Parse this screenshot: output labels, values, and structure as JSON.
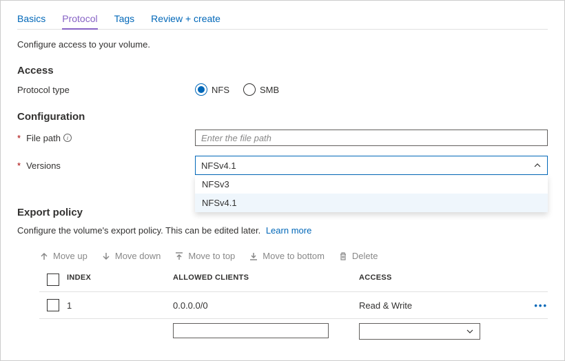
{
  "tabs": {
    "basics": "Basics",
    "protocol": "Protocol",
    "tags": "Tags",
    "review": "Review + create"
  },
  "description": "Configure access to your volume.",
  "access": {
    "heading": "Access",
    "protocol_label": "Protocol type",
    "nfs": "NFS",
    "smb": "SMB"
  },
  "configuration": {
    "heading": "Configuration",
    "file_path_label": "File path",
    "file_path_placeholder": "Enter the file path",
    "versions_label": "Versions",
    "versions_selected": "NFSv4.1",
    "versions_options": [
      "NFSv3",
      "NFSv4.1"
    ]
  },
  "export_policy": {
    "heading": "Export policy",
    "desc": "Configure the volume's export policy. This can be edited later.",
    "learn_more": "Learn more"
  },
  "toolbar": {
    "move_up": "Move up",
    "move_down": "Move down",
    "move_top": "Move to top",
    "move_bottom": "Move to bottom",
    "delete": "Delete"
  },
  "table": {
    "headers": {
      "index": "INDEX",
      "clients": "ALLOWED CLIENTS",
      "access": "ACCESS"
    },
    "rows": [
      {
        "index": "1",
        "clients": "0.0.0.0/0",
        "access": "Read & Write"
      }
    ]
  }
}
